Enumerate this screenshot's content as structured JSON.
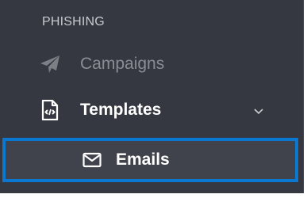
{
  "sidebar": {
    "section_title": "PHISHING",
    "items": [
      {
        "label": "Campaigns",
        "icon": "paper-plane-icon",
        "state": "disabled"
      },
      {
        "label": "Templates",
        "icon": "code-file-icon",
        "expandable": true,
        "expanded": true,
        "chevron": "chevron-down-icon"
      },
      {
        "label": "Emails",
        "icon": "envelope-icon",
        "selected": true
      }
    ]
  },
  "colors": {
    "sidebar_bg": "#363841",
    "selected_bg": "#41434c",
    "highlight_border": "#0a78d0",
    "muted_text": "#8b8d95",
    "active_text": "#ffffff"
  }
}
